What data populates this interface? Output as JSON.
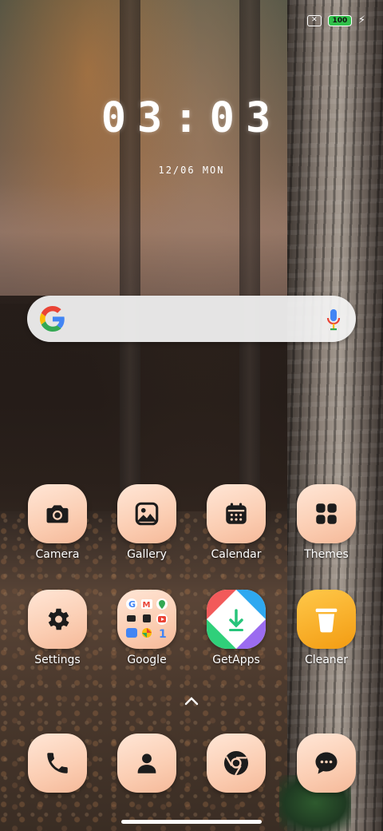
{
  "status_bar": {
    "battery_level": "100",
    "sim_icon": "no-sim-icon",
    "charging_icon": "charging-bolt-icon"
  },
  "lock": {
    "time": "03:03",
    "date": "12/06 MON"
  },
  "search_bar": {
    "logo": "google-g-icon",
    "mic": "microphone-icon"
  },
  "apps": [
    {
      "label": "Camera",
      "icon": "camera-icon"
    },
    {
      "label": "Gallery",
      "icon": "image-icon"
    },
    {
      "label": "Calendar",
      "icon": "calendar-icon"
    },
    {
      "label": "Themes",
      "icon": "grid-icon"
    },
    {
      "label": "Settings",
      "icon": "gear-icon"
    },
    {
      "label": "Google",
      "icon": "google-folder-icon"
    },
    {
      "label": "GetApps",
      "icon": "getapps-icon"
    },
    {
      "label": "Cleaner",
      "icon": "trash-icon"
    }
  ],
  "dock": [
    {
      "name": "Phone",
      "icon": "phone-icon"
    },
    {
      "name": "Contacts",
      "icon": "person-icon"
    },
    {
      "name": "Chrome",
      "icon": "chrome-icon"
    },
    {
      "name": "Messages",
      "icon": "chat-bubble-icon"
    }
  ],
  "colors": {
    "icon_tile": "#fbcdb2",
    "glyph": "#1c1c1c",
    "cleaner_tile": "#f7b028",
    "battery": "#30c04a"
  }
}
